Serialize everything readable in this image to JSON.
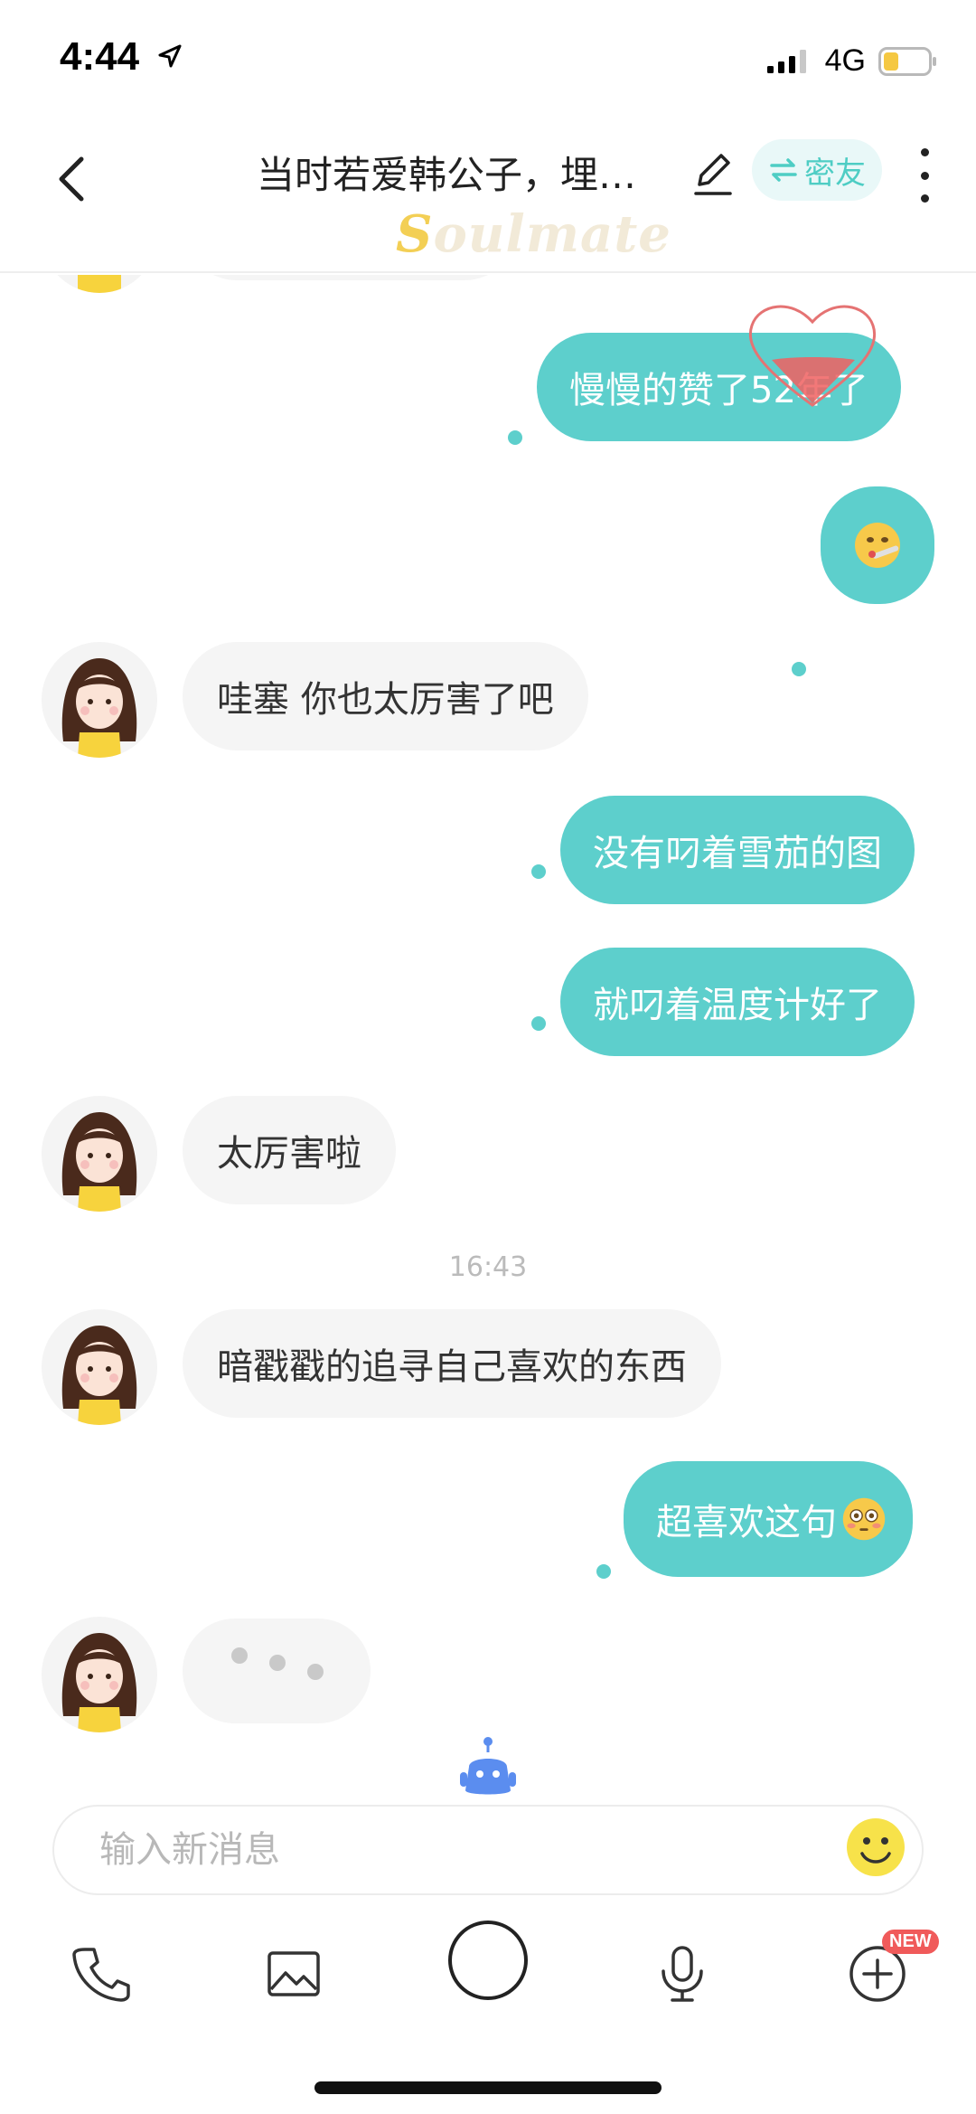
{
  "status_bar": {
    "time": "4:44",
    "carrier": "4G",
    "battery_level": 0.35,
    "battery_color": "#f5c842"
  },
  "header": {
    "title": "当时若爱韩公子，埋…",
    "relation_label": "密友",
    "brand": "Soulmate",
    "accent_color": "#4ecdc4"
  },
  "messages": [
    {
      "side": "out",
      "text": "慢慢的赞了52年了"
    },
    {
      "side": "out",
      "emoji": "face-with-thermometer-emoji"
    },
    {
      "side": "in",
      "text": "哇塞 你也太厉害了吧"
    },
    {
      "side": "out",
      "text": "没有叼着雪茄的图"
    },
    {
      "side": "out",
      "text": "就叼着温度计好了"
    },
    {
      "side": "in",
      "text": "太厉害啦"
    },
    {
      "side": "time",
      "text": "16:43"
    },
    {
      "side": "in",
      "text": "暗戳戳的追寻自己喜欢的东西"
    },
    {
      "side": "out",
      "text": "超喜欢这句",
      "emoji": "flushed-face-emoji"
    },
    {
      "side": "in",
      "typing": true
    }
  ],
  "composer": {
    "placeholder": "输入新消息"
  },
  "toolbar": {
    "items": [
      "phone-icon",
      "image-icon",
      "capture-icon",
      "microphone-icon",
      "plus-icon"
    ],
    "new_badge": "NEW"
  },
  "colors": {
    "bubble_out": "#5dcfcc",
    "bubble_in": "#f5f5f5"
  }
}
